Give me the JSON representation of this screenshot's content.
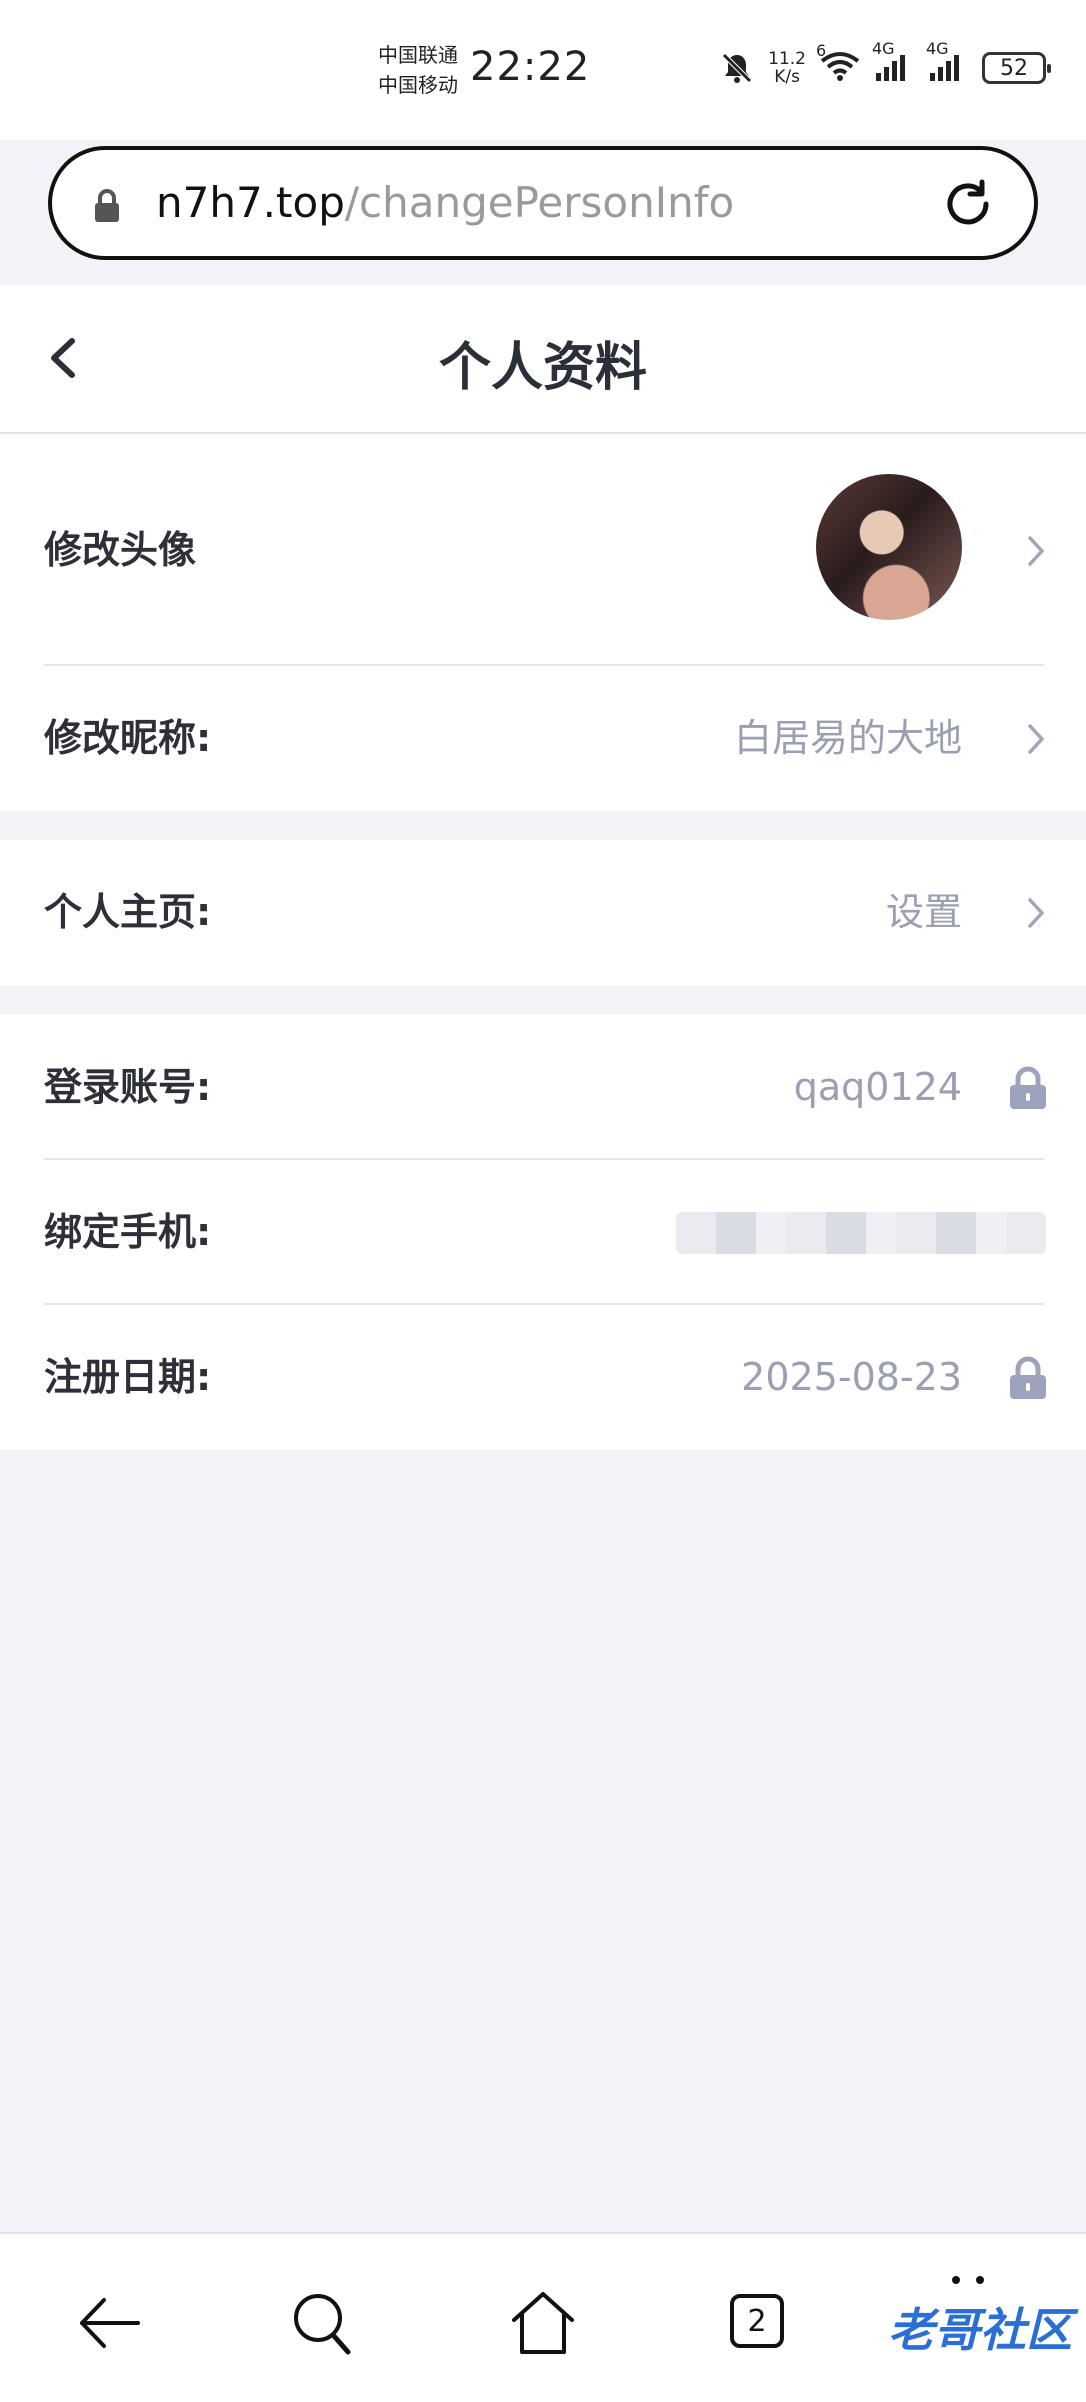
{
  "status_bar": {
    "carrier_1": "中国联通",
    "carrier_2": "中国移动",
    "time": "22:22",
    "net_speed_value": "11.2",
    "net_speed_unit": "K/s",
    "wifi_label": "6",
    "signal_1_label": "4G",
    "signal_2_label": "4G",
    "battery": "52"
  },
  "browser": {
    "url_host": "n7h7.top",
    "url_path": "/changePersonInfo"
  },
  "header": {
    "title": "个人资料"
  },
  "profile": {
    "avatar_label": "修改头像",
    "nickname_label": "修改昵称:",
    "nickname_value": "白居易的大地",
    "homepage_label": "个人主页:",
    "homepage_value": "设置",
    "account_label": "登录账号:",
    "account_value": "qaq0124",
    "phone_label": "绑定手机:",
    "register_label": "注册日期:",
    "register_value": "2025-08-23"
  },
  "bottom_nav": {
    "tab_count": "2"
  },
  "watermark": "老哥社区",
  "colors": {
    "page_bg": "#f2f3f8",
    "muted_text": "#9a9fb3",
    "lock_icon": "#9ea3bd"
  }
}
